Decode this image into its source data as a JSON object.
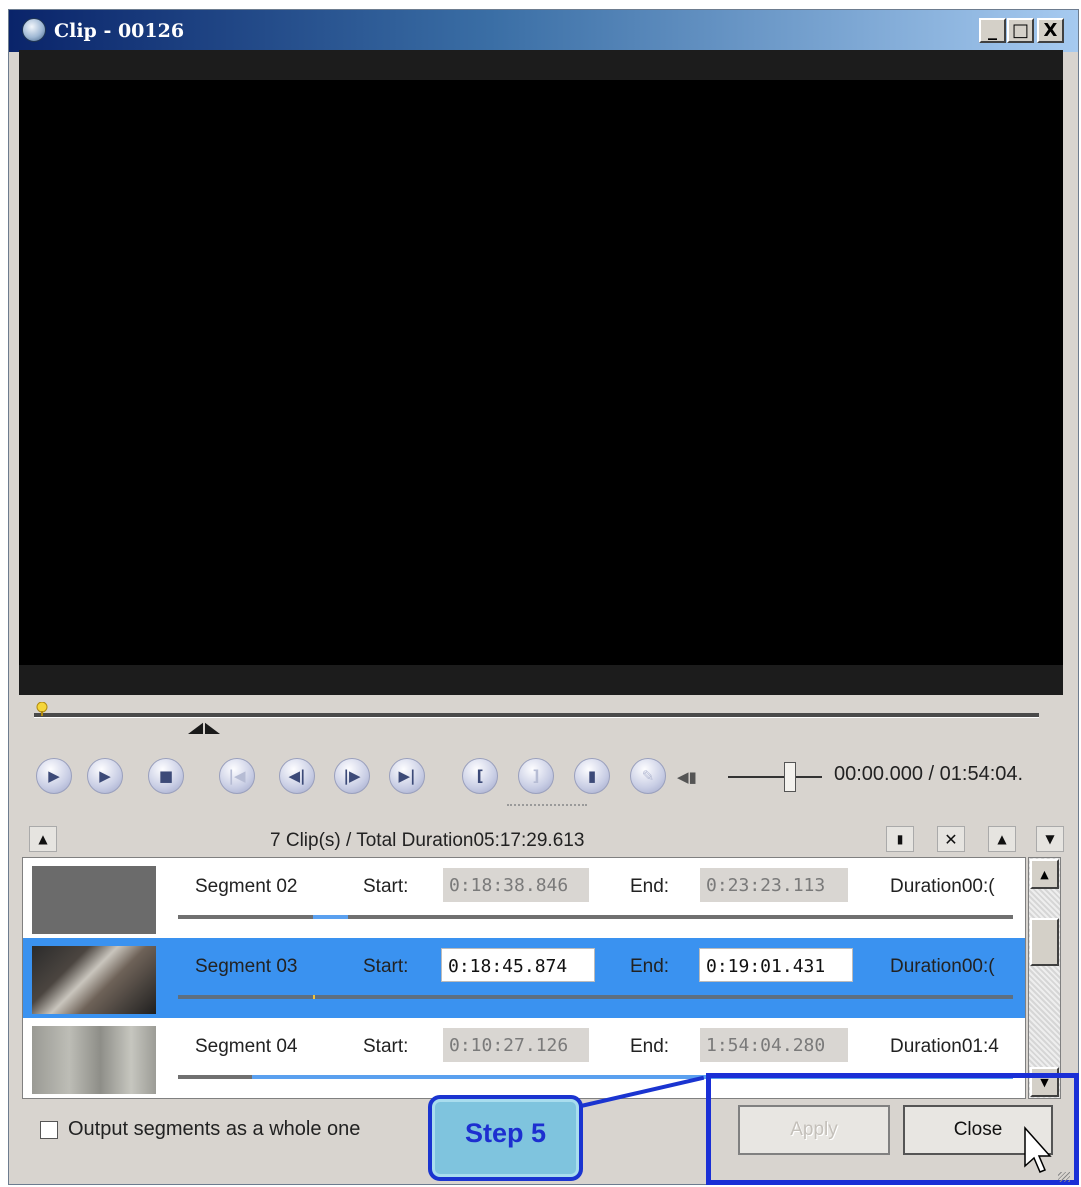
{
  "window": {
    "title": "Clip - 00126",
    "minimize_label": "_",
    "maximize_label": "□",
    "close_label": "X"
  },
  "player": {
    "timecode": "00:00.000 / 01:54:04.",
    "controls": [
      "play-icon",
      "play-to-icon",
      "stop-icon",
      "go-start-icon",
      "prev-frame-icon",
      "next-frame-icon",
      "go-end-icon",
      "mark-in-icon",
      "mark-out-icon",
      "add-segment-icon",
      "edit-icon"
    ],
    "volume_level": 0.6
  },
  "segments_header": {
    "summary": "7 Clip(s) /  Total Duration05:17:29.613"
  },
  "segments": [
    {
      "name": "Segment 02",
      "start_label": "Start:",
      "start": "0:18:38.846",
      "end_label": "End:",
      "end": "0:23:23.113",
      "duration": "Duration00:(",
      "selected": false,
      "thumb": "gray-frame"
    },
    {
      "name": "Segment 03",
      "start_label": "Start:",
      "start": "0:18:45.874",
      "end_label": "End:",
      "end": "0:19:01.431",
      "duration": "Duration00:(",
      "selected": true,
      "thumb": "cards-frame"
    },
    {
      "name": "Segment 04",
      "start_label": "Start:",
      "start": "0:10:27.126",
      "end_label": "End:",
      "end": "1:54:04.280",
      "duration": "Duration01:4",
      "selected": false,
      "thumb": "soldiers-frame"
    }
  ],
  "footer": {
    "checkbox_label": "Output segments as a whole one",
    "checkbox_checked": false,
    "apply_label": "Apply",
    "close_label": "Close"
  },
  "annotation": {
    "step_label": "Step 5",
    "color": "#1a2fd6"
  },
  "colors": {
    "selection": "#3a92f0",
    "titlebar_start": "#0a246a",
    "titlebar_end": "#a6caf0"
  }
}
